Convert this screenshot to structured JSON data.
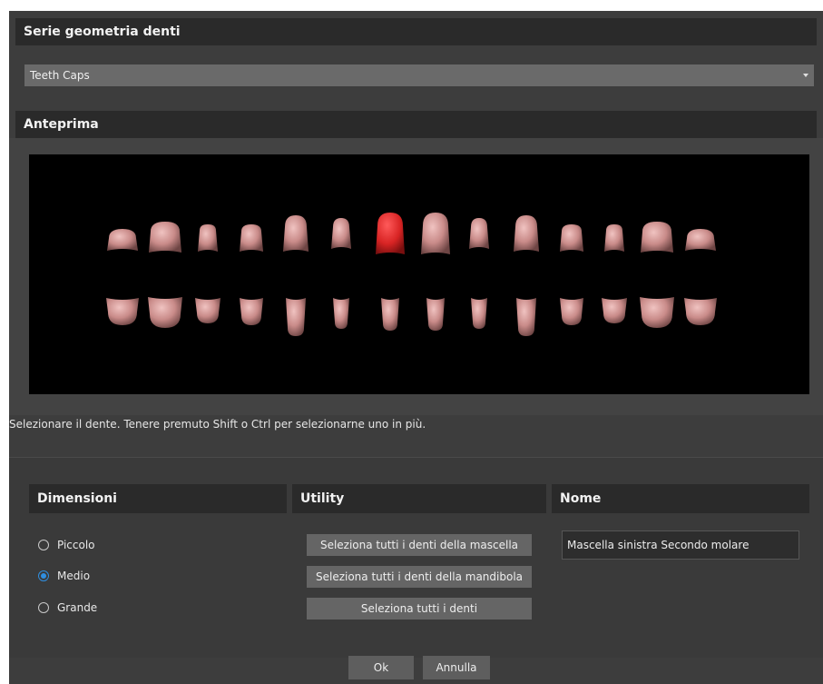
{
  "series_section": {
    "header": "Serie geometria denti",
    "select_value": "Teeth Caps"
  },
  "preview_section": {
    "header": "Anteprima",
    "hint": "Selezionare il dente. Tenere premuto Shift o Ctrl per selezionarne uno in più."
  },
  "dimensions": {
    "header": "Dimensioni",
    "options": [
      {
        "label": "Piccolo",
        "checked": false
      },
      {
        "label": "Medio",
        "checked": true
      },
      {
        "label": "Grande",
        "checked": false
      }
    ]
  },
  "utility": {
    "header": "Utility",
    "buttons": [
      "Seleziona tutti i denti della mascella",
      "Seleziona tutti i denti della mandibola",
      "Seleziona tutti i denti"
    ]
  },
  "name": {
    "header": "Nome",
    "value": "Mascella sinistra Secondo molare"
  },
  "footer": {
    "ok_label": "Ok",
    "cancel_label": "Annulla"
  },
  "colors": {
    "tooth": "#d29a98",
    "tooth_selected": "#d82424",
    "accent": "#2f8fe0"
  },
  "teeth": {
    "upper_count": 14,
    "lower_count": 14,
    "selected_upper_index": 6
  }
}
